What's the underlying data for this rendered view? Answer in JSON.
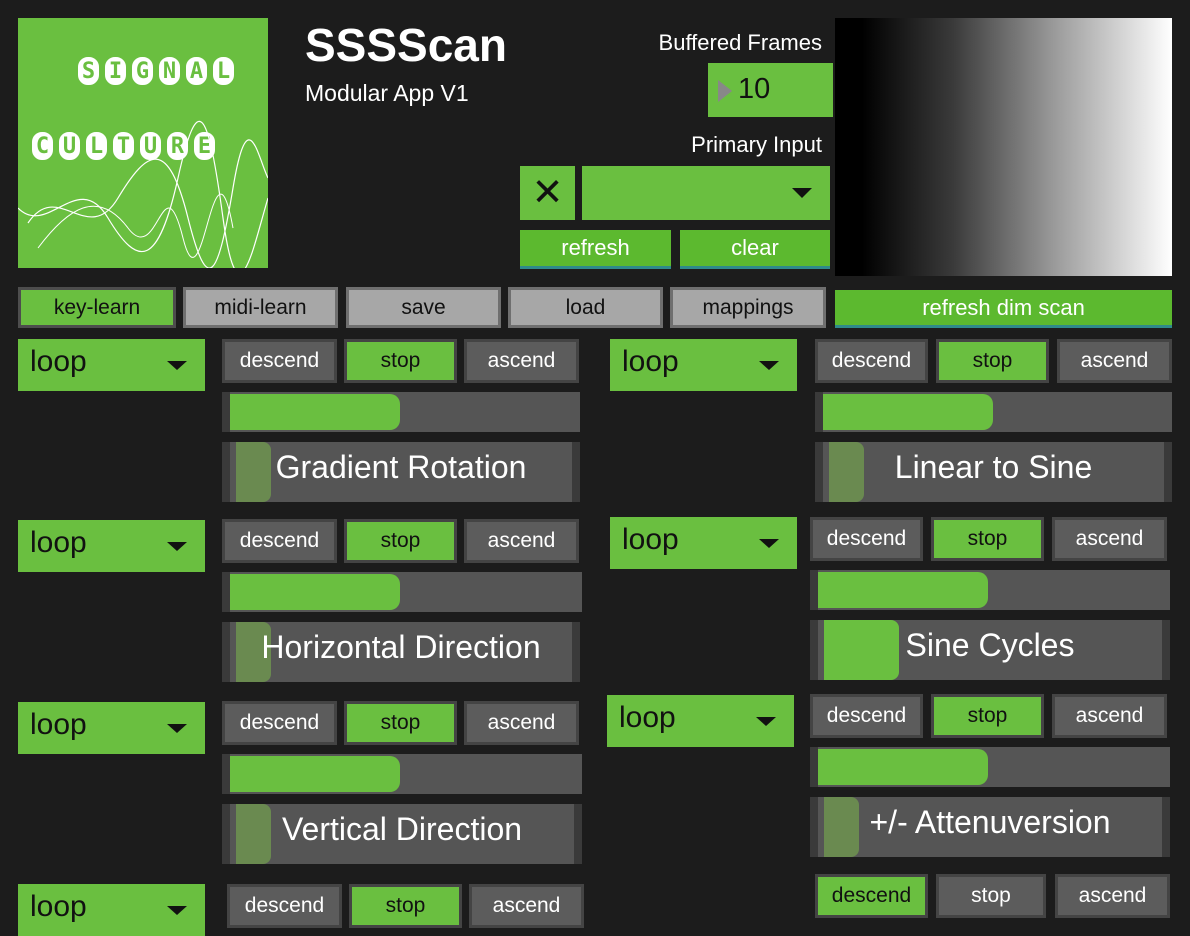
{
  "header": {
    "logo_line1": [
      "S",
      "I",
      "G",
      "N",
      "A",
      "L"
    ],
    "logo_line2": [
      "C",
      "U",
      "L",
      "T",
      "U",
      "R",
      "E"
    ],
    "title": "SSSScan",
    "subtitle": "Modular App V1"
  },
  "buffer": {
    "label": "Buffered Frames",
    "value": "10"
  },
  "primary_input": {
    "label": "Primary Input",
    "selected": "",
    "clear_glyph": "✕",
    "refresh_label": "refresh",
    "clear_label": "clear"
  },
  "toolbar": {
    "key_learn": "key-learn",
    "midi_learn": "midi-learn",
    "save": "save",
    "load": "load",
    "mappings": "mappings",
    "refresh_dim_scan": "refresh dim scan"
  },
  "modules": [
    {
      "mode": "loop",
      "descend": "descend",
      "stop": "stop",
      "ascend": "ascend",
      "param": "Gradient Rotation",
      "active": "stop",
      "speed": 0.48
    },
    {
      "mode": "loop",
      "descend": "descend",
      "stop": "stop",
      "ascend": "ascend",
      "param": "Horizontal Direction",
      "active": "stop",
      "speed": 0.48
    },
    {
      "mode": "loop",
      "descend": "descend",
      "stop": "stop",
      "ascend": "ascend",
      "param": "Vertical Direction",
      "active": "stop",
      "speed": 0.48
    },
    {
      "mode": "loop",
      "descend": "descend",
      "stop": "stop",
      "ascend": "ascend",
      "param": "",
      "active": "stop"
    },
    {
      "mode": "loop",
      "descend": "descend",
      "stop": "stop",
      "ascend": "ascend",
      "param": "Linear to Sine",
      "active": "stop",
      "speed": 0.47
    },
    {
      "mode": "loop",
      "descend": "descend",
      "stop": "stop",
      "ascend": "ascend",
      "param": "Sine Cycles",
      "active": "stop",
      "speed": 0.47
    },
    {
      "mode": "loop",
      "descend": "descend",
      "stop": "stop",
      "ascend": "ascend",
      "param": "+/- Attenuversion",
      "active": "stop",
      "speed": 0.47
    },
    {
      "mode": "",
      "descend": "descend",
      "stop": "stop",
      "ascend": "ascend",
      "param": "",
      "active": "descend"
    }
  ],
  "colors": {
    "accent_green": "#6abf40",
    "background": "#1c1c1c",
    "button_gray": "#5c5c5c"
  }
}
